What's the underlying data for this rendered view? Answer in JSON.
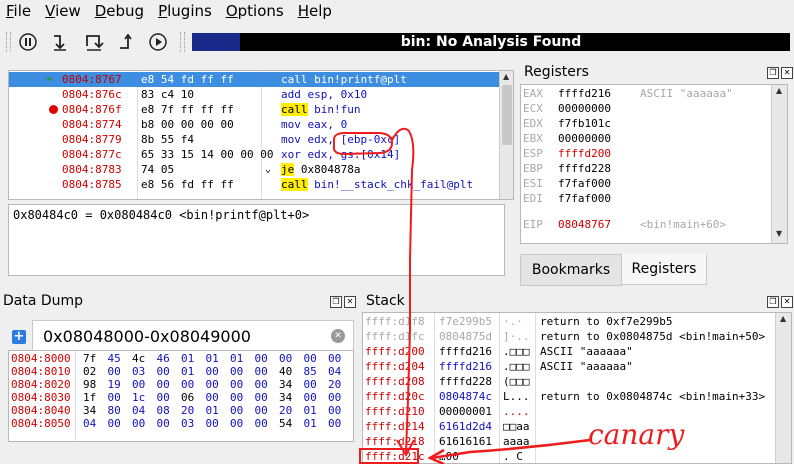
{
  "menu": [
    "File",
    "View",
    "Debug",
    "Plugins",
    "Options",
    "Help"
  ],
  "toolbar": {
    "buttons": [
      "pause-icon",
      "step-into-icon",
      "step-over-icon",
      "step-out-icon",
      "run-icon"
    ],
    "status_text": "bin: No Analysis Found",
    "progress_fraction": 0.08
  },
  "disasm": {
    "rows": [
      {
        "addr": "0804:8767",
        "bytes": "e8 54 fd ff ff",
        "instr": "call bin!printf@plt",
        "marker": "arrow"
      },
      {
        "addr": "0804:876c",
        "bytes": "83 c4 10",
        "instr": "add esp, 0x10",
        "marker": ""
      },
      {
        "addr": "0804:876f",
        "bytes": "e8 7f ff ff ff",
        "instr": "call bin!fun",
        "marker": "breakpoint"
      },
      {
        "addr": "0804:8774",
        "bytes": "b8 00 00 00 00",
        "instr": "mov eax, 0",
        "marker": ""
      },
      {
        "addr": "0804:8779",
        "bytes": "8b 55 f4",
        "instr": "mov edx, [ebp-0xc]",
        "marker": ""
      },
      {
        "addr": "0804:877c",
        "bytes": "65 33 15 14 00 00 00",
        "instr": "xor edx, gs:[0x14]",
        "marker": ""
      },
      {
        "addr": "0804:8783",
        "bytes": "74 05",
        "instr": "je 0x804878a",
        "marker": ""
      },
      {
        "addr": "0804:8785",
        "bytes": "e8 56 fd ff ff",
        "instr": "call bin!__stack_chk_fail@plt",
        "marker": ""
      }
    ]
  },
  "info_text": "0x80484c0 = 0x080484c0 <bin!printf@plt+0>",
  "registers": {
    "title": "Registers",
    "rows": [
      {
        "name": "EAX",
        "value": "ffffd216",
        "comment": "ASCII \"aaaaaa\"",
        "changed": false
      },
      {
        "name": "ECX",
        "value": "00000000",
        "comment": "",
        "changed": false
      },
      {
        "name": "EDX",
        "value": "f7fb101c",
        "comment": "",
        "changed": false
      },
      {
        "name": "EBX",
        "value": "00000000",
        "comment": "",
        "changed": false
      },
      {
        "name": "ESP",
        "value": "ffffd200",
        "comment": "",
        "changed": true
      },
      {
        "name": "EBP",
        "value": "ffffd228",
        "comment": "",
        "changed": false
      },
      {
        "name": "ESI",
        "value": "f7faf000",
        "comment": "",
        "changed": false
      },
      {
        "name": "EDI",
        "value": "f7faf000",
        "comment": "",
        "changed": false
      },
      {
        "name": "EIP",
        "value": "08048767",
        "comment": "<bin!main+60>",
        "changed": true
      }
    ],
    "tabs": [
      "Bookmarks",
      "Registers"
    ],
    "active_tab": "Registers"
  },
  "data_dump": {
    "title": "Data Dump",
    "tab": "0x08048000-0x08049000",
    "rows": [
      {
        "addr": "0804:8000",
        "bytes": [
          "7f",
          "45",
          "4c",
          "46",
          "01",
          "01",
          "01",
          "00",
          "00",
          "00",
          "00"
        ]
      },
      {
        "addr": "0804:8010",
        "bytes": [
          "02",
          "00",
          "03",
          "00",
          "01",
          "00",
          "00",
          "00",
          "40",
          "85",
          "04"
        ]
      },
      {
        "addr": "0804:8020",
        "bytes": [
          "98",
          "19",
          "00",
          "00",
          "00",
          "00",
          "00",
          "00",
          "34",
          "00",
          "20"
        ]
      },
      {
        "addr": "0804:8030",
        "bytes": [
          "1f",
          "00",
          "1c",
          "00",
          "06",
          "00",
          "00",
          "00",
          "34",
          "00",
          "00"
        ]
      },
      {
        "addr": "0804:8040",
        "bytes": [
          "34",
          "80",
          "04",
          "08",
          "20",
          "01",
          "00",
          "00",
          "20",
          "01",
          "00"
        ]
      },
      {
        "addr": "0804:8050",
        "bytes": [
          "04",
          "00",
          "00",
          "00",
          "03",
          "00",
          "00",
          "00",
          "54",
          "01",
          "00"
        ]
      }
    ]
  },
  "stack": {
    "title": "Stack",
    "rows": [
      {
        "addr": "ffff:d1f8",
        "value": "f7e299b5",
        "ascii": "·.·",
        "comment": "return to 0xf7e299b5",
        "dim": true
      },
      {
        "addr": "ffff:d1fc",
        "value": "0804875d",
        "ascii": "]·..",
        "comment": "return to 0x0804875d <bin!main+50>",
        "dim": true
      },
      {
        "addr": "ffff:d200",
        "value": "ffffd216",
        "ascii": ".□□□",
        "comment": "ASCII \"aaaaaa\"",
        "dim": false
      },
      {
        "addr": "ffff:d204",
        "value": "ffffd216",
        "ascii": ".□□□",
        "comment": "ASCII \"aaaaaa\"",
        "dim": false
      },
      {
        "addr": "ffff:d208",
        "value": "ffffd228",
        "ascii": "(□□□",
        "comment": "",
        "dim": false
      },
      {
        "addr": "ffff:d20c",
        "value": "0804874c",
        "ascii": "L...",
        "comment": "return to 0x0804874c <bin!main+33>",
        "dim": false
      },
      {
        "addr": "ffff:d210",
        "value": "00000001",
        "ascii": "....",
        "comment": "",
        "dim": false
      },
      {
        "addr": "ffff:d214",
        "value": "6161d2d4",
        "ascii": "□□aa",
        "comment": "",
        "dim": false
      },
      {
        "addr": "ffff:d218",
        "value": "61616161",
        "ascii": "aaaa",
        "comment": "",
        "dim": false
      },
      {
        "addr": "ffff:d21c",
        "value": "…00",
        "ascii": ". C",
        "comment": "",
        "dim": false
      }
    ]
  },
  "annotation": {
    "text": "canary",
    "color": "#ee1c1c"
  }
}
